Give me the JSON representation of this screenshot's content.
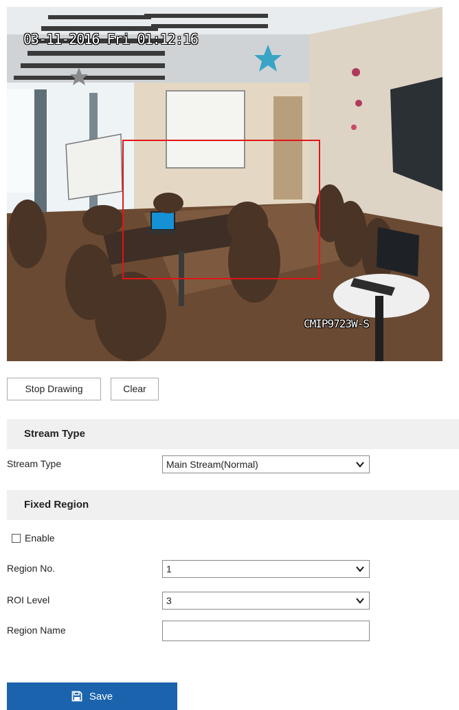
{
  "video": {
    "osd_timestamp": "03-11-2016 Fri 01:12:16",
    "osd_camera_name": "CMIP9723W-S"
  },
  "drawing": {
    "stop_label": "Stop Drawing",
    "clear_label": "Clear"
  },
  "stream_section": {
    "header": "Stream Type",
    "stream_type_label": "Stream Type",
    "stream_type_value": "Main Stream(Normal)"
  },
  "fixed_region_section": {
    "header": "Fixed Region",
    "enable_label": "Enable",
    "enable_checked": false,
    "region_no_label": "Region No.",
    "region_no_value": "1",
    "roi_level_label": "ROI Level",
    "roi_level_value": "3",
    "region_name_label": "Region Name",
    "region_name_value": ""
  },
  "save": {
    "label": "Save",
    "color": "#1b63ad"
  },
  "colors": {
    "roi_box": "#e01515",
    "section_bg": "#f0f0f0"
  },
  "icons": {
    "save": "floppy-disk-icon",
    "dropdown": "chevron-down-icon"
  }
}
